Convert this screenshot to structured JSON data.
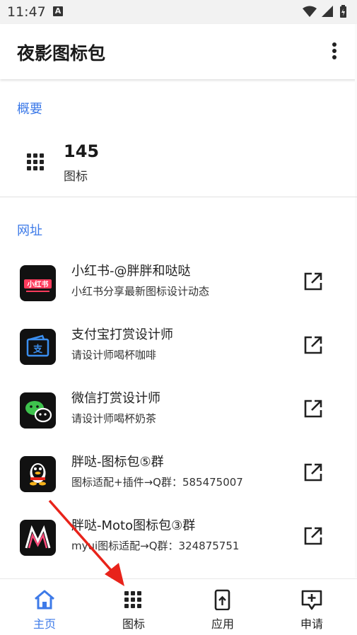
{
  "status": {
    "time": "11:47",
    "badge": "A"
  },
  "app": {
    "title": "夜影图标包",
    "menu_icon": "more-vertical-icon"
  },
  "summary": {
    "header": "概要",
    "count": "145",
    "label": "图标"
  },
  "links": {
    "header": "网址",
    "items": [
      {
        "title": "小红书-@胖胖和哒哒",
        "subtitle": "小红书分享最新图标设计动态",
        "icon_text": "小红书"
      },
      {
        "title": "支付宝打赏设计师",
        "subtitle": "请设计师喝杯咖啡",
        "icon_text": "支"
      },
      {
        "title": "微信打赏设计师",
        "subtitle": "请设计师喝杯奶茶"
      },
      {
        "title": "胖哒-图标包⑤群",
        "subtitle": "图标适配+插件→Q群：585475007"
      },
      {
        "title": "胖哒-Moto图标包③群",
        "subtitle": "myui图标适配→Q群：324875751"
      }
    ]
  },
  "nav": {
    "items": [
      {
        "label": "主页",
        "active": true
      },
      {
        "label": "图标"
      },
      {
        "label": "应用"
      },
      {
        "label": "申请"
      }
    ]
  },
  "colors": {
    "accent": "#3d7ae8",
    "annotation": "#e8231a"
  }
}
